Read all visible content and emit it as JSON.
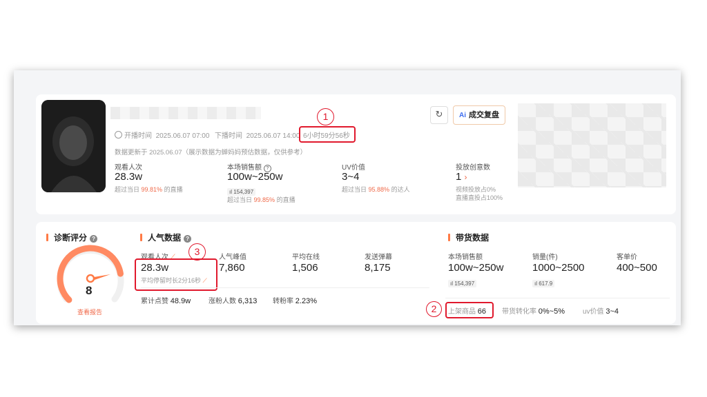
{
  "header": {
    "start_label": "开播时间",
    "start_time": "2025.06.07 07:00",
    "end_label": "下播时间",
    "end_time": "2025.06.07 14:00",
    "duration": "6小时59分56秒",
    "update_note": "数据更新于 2025.06.07（展示数据为蝉妈妈预估数据，仅供参考）",
    "ai_button": "成交复盘",
    "ai_prefix": "Ai"
  },
  "top_stats": {
    "viewers": {
      "label": "观看人次",
      "value": "28.3w",
      "note_pre": "超过当日",
      "pct": "99.81%",
      "note_post": "的直播"
    },
    "sales": {
      "label": "本场销售额",
      "value": "100w~250w",
      "chip": "154,397",
      "note_pre": "超过当日",
      "pct": "99.85%",
      "note_post": "的直播"
    },
    "uv": {
      "label": "UV价值",
      "value": "3~4",
      "note_pre": "超过当日",
      "pct": "95.88%",
      "note_post": "的达人"
    },
    "creative": {
      "label": "投放创意数",
      "value": "1",
      "line1": "视频投放占0%",
      "line2": "直播直投占100%"
    }
  },
  "diagnosis": {
    "title": "诊断评分",
    "score": "8",
    "link": "查看报告",
    "gauge_fraction": 0.8
  },
  "popularity": {
    "title": "人气数据",
    "viewers": {
      "label": "观看人次",
      "value": "28.3w",
      "stay": "平均停留时长2分16秒"
    },
    "peak": {
      "label": "人气峰值",
      "value": "7,860"
    },
    "online": {
      "label": "平均在线",
      "value": "1,506"
    },
    "danmu": {
      "label": "发送弹幕",
      "value": "8,175"
    },
    "likes": {
      "label": "累计点赞",
      "value": "48.9w"
    },
    "fans": {
      "label": "涨粉人数",
      "value": "6,313"
    },
    "convert": {
      "label": "转粉率",
      "value": "2.23%"
    }
  },
  "goods": {
    "title": "带货数据",
    "sales": {
      "label": "本场销售额",
      "value": "100w~250w",
      "chip": "154,397"
    },
    "volume": {
      "label": "销量(件)",
      "value": "1000~2500",
      "chip": "617.9"
    },
    "price": {
      "label": "客单价",
      "value": "400~500"
    },
    "listed": {
      "label": "上架商品",
      "value": "66"
    },
    "rate": {
      "label": "带货转化率",
      "value": "0%~5%"
    },
    "uv": {
      "label": "uv价值",
      "value": "3~4"
    }
  },
  "annotations": {
    "one": "1",
    "two": "2",
    "three": "3"
  },
  "colors": {
    "accent": "#ff7a45",
    "highlight": "#e0182c",
    "pct": "#f06a4a"
  }
}
